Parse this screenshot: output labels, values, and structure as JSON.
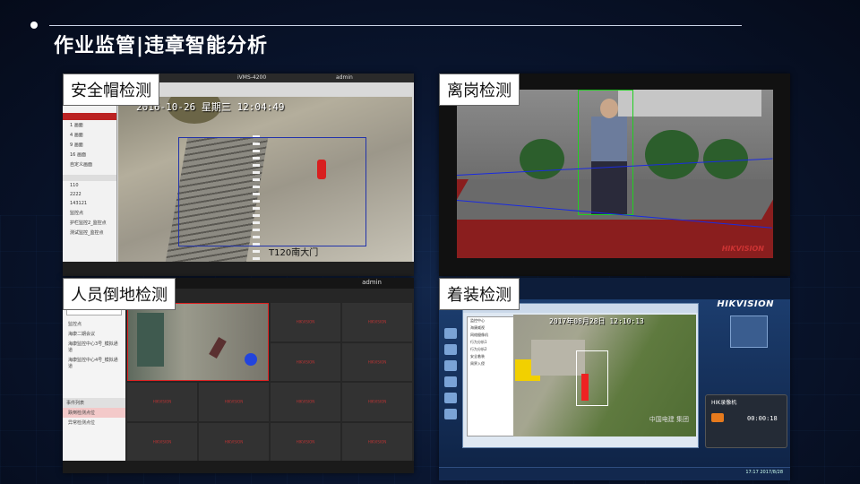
{
  "slide": {
    "title": "作业监管|违章智能分析",
    "bg_color": "#0a1630",
    "line_color": "#c9d3e6"
  },
  "panels": [
    {
      "label": "安全帽检测",
      "window_title": "iVMS-4200",
      "timestamp": "2016-10-26  星期三  12:04:49",
      "caption": "T120南大门",
      "menu": [
        "1 画面",
        "4 画面",
        "9 画面",
        "16 画面",
        "自定义画面"
      ],
      "tree": [
        "110",
        "2222",
        "143121",
        "监控点",
        "护栏监控2_监控点",
        "测试监控_监控点"
      ],
      "user": "admin"
    },
    {
      "label": "离岗检测",
      "watermark": "HIKVISION",
      "box_color": "#20d020",
      "zone_color": "#1a2be0"
    },
    {
      "label": "人员倒地检测",
      "user": "admin",
      "search_placeholder": "搜索",
      "tree": [
        "监控点",
        "海康二期会议",
        "海康监控中心3号_模拟通道",
        "海康监控中心4号_模拟通道"
      ],
      "section": "事件列表",
      "events": [
        "跌倒检测点位",
        "异常检测点位"
      ],
      "cell_logo": "HIKVISION"
    },
    {
      "label": "着装检测",
      "brand": "HIKVISION",
      "timestamp": "2017年08月28日  12:10:13",
      "tree": [
        "监控中心",
        "海康威视",
        "网络摄像机",
        "行为分析1",
        "行为分析2",
        "安全着装",
        "周界入侵"
      ],
      "video_wm": "中国电建\n集团",
      "ctl_title": "HIK录像机",
      "ctl_time": "00:00:18",
      "tray_time": "17:17\n2017/8/28"
    }
  ]
}
